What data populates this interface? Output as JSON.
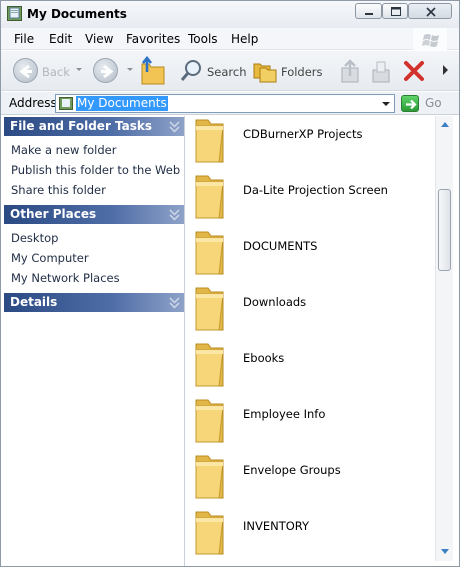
{
  "window": {
    "title": "My Documents",
    "icon": "my-documents-icon"
  },
  "menu": {
    "items": [
      "File",
      "Edit",
      "View",
      "Favorites",
      "Tools",
      "Help"
    ]
  },
  "toolbar": {
    "back_label": "Back",
    "search_label": "Search",
    "folders_label": "Folders"
  },
  "address": {
    "label": "Address",
    "value": "My Documents",
    "go_label": "Go"
  },
  "left_pane": {
    "file_tasks": {
      "title": "File and Folder Tasks",
      "items": [
        "Make a new folder",
        "Publish this folder to the Web",
        "Share this folder"
      ]
    },
    "other_places": {
      "title": "Other Places",
      "items": [
        "Desktop",
        "My Computer",
        "My Network Places"
      ]
    },
    "details": {
      "title": "Details"
    }
  },
  "files": [
    "CDBurnerXP Projects",
    "Da-Lite Projection Screen",
    "DOCUMENTS",
    "Downloads",
    "Ebooks",
    "Employee Info",
    "Envelope Groups",
    "INVENTORY"
  ],
  "colors": {
    "task_header": "#2b4a83",
    "selection": "#3399ff",
    "folder": "#f2d06b",
    "close_icon": "#d3312b"
  }
}
